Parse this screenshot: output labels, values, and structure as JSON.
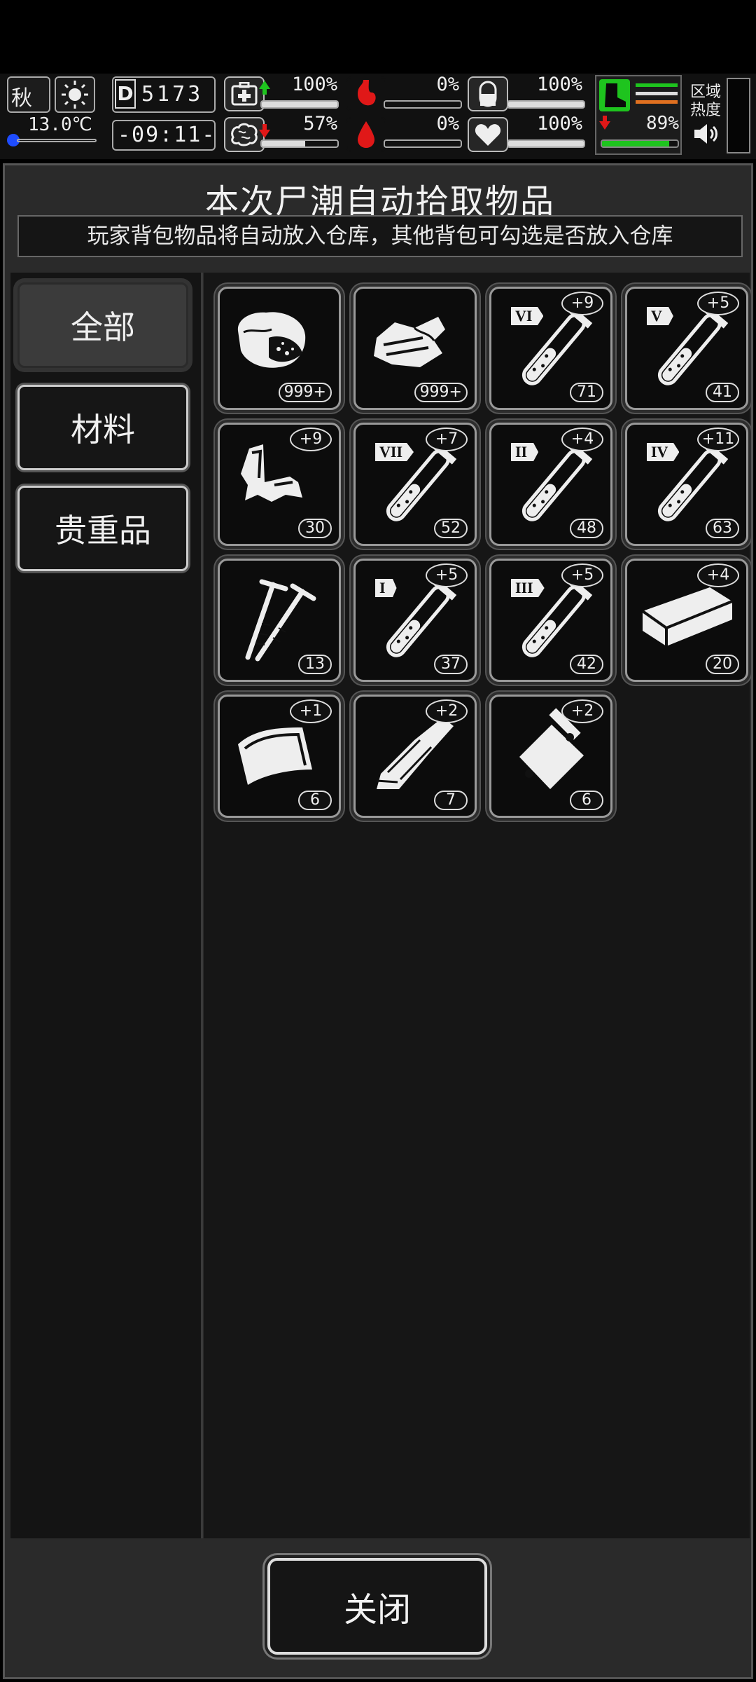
{
  "hud": {
    "season": "秋",
    "temperature": "13.0℃",
    "day": "5173",
    "time": "-09:11-",
    "stats": [
      {
        "icon": "first-aid-icon",
        "value": "100%",
        "trend": "up",
        "fill": 1.0
      },
      {
        "icon": "stomach-icon",
        "value": "0%",
        "trend": "none",
        "fill": 0.0
      },
      {
        "icon": "pill-icon",
        "value": "100%",
        "trend": "none",
        "fill": 1.0
      },
      {
        "icon": "brain-icon",
        "value": "57%",
        "trend": "down",
        "fill": 0.57
      },
      {
        "icon": "blood-drop-icon",
        "value": "0%",
        "trend": "none",
        "fill": 0.0
      },
      {
        "icon": "heart-icon",
        "value": "100%",
        "trend": "none",
        "fill": 1.0
      }
    ],
    "stamina": {
      "value": "89%",
      "trend": "down",
      "fill": 0.89
    },
    "area_heat_label": "区域\n热度",
    "colors": {
      "green": "#1ec41e",
      "red": "#e01818",
      "orange": "#e07020"
    }
  },
  "panel": {
    "title": "本次尸潮自动拾取物品",
    "subtitle": "玩家背包物品将自动放入仓库，其他背包可勾选是否放入仓库"
  },
  "categories": [
    {
      "label": "全部",
      "selected": true
    },
    {
      "label": "材料",
      "selected": false
    },
    {
      "label": "贵重品",
      "selected": false
    }
  ],
  "items": [
    {
      "icon": "raw-meat-icon",
      "count": "999+",
      "plus": ""
    },
    {
      "icon": "cloth-icon",
      "count": "999+",
      "plus": ""
    },
    {
      "icon": "serum-vial-icon",
      "tier": "VI",
      "count": "71",
      "plus": "+9"
    },
    {
      "icon": "serum-vial-icon",
      "tier": "V",
      "count": "41",
      "plus": "+5"
    },
    {
      "icon": "scrap-metal-icon",
      "count": "30",
      "plus": "+9"
    },
    {
      "icon": "serum-vial-icon",
      "tier": "VII",
      "count": "52",
      "plus": "+7"
    },
    {
      "icon": "serum-vial-icon",
      "tier": "II",
      "count": "48",
      "plus": "+4"
    },
    {
      "icon": "serum-vial-icon",
      "tier": "IV",
      "count": "63",
      "plus": "+11"
    },
    {
      "icon": "screws-icon",
      "count": "13",
      "plus": ""
    },
    {
      "icon": "serum-vial-icon",
      "tier": "I",
      "count": "37",
      "plus": "+5"
    },
    {
      "icon": "serum-vial-icon",
      "tier": "III",
      "count": "42",
      "plus": "+5"
    },
    {
      "icon": "wood-plank-icon",
      "count": "20",
      "plus": "+4"
    },
    {
      "icon": "plastic-sheet-icon",
      "count": "6",
      "plus": "+1"
    },
    {
      "icon": "bandage-roll-icon",
      "count": "7",
      "plus": "+2"
    },
    {
      "icon": "plastic-bag-icon",
      "count": "6",
      "plus": "+2"
    }
  ],
  "close_label": "关闭"
}
